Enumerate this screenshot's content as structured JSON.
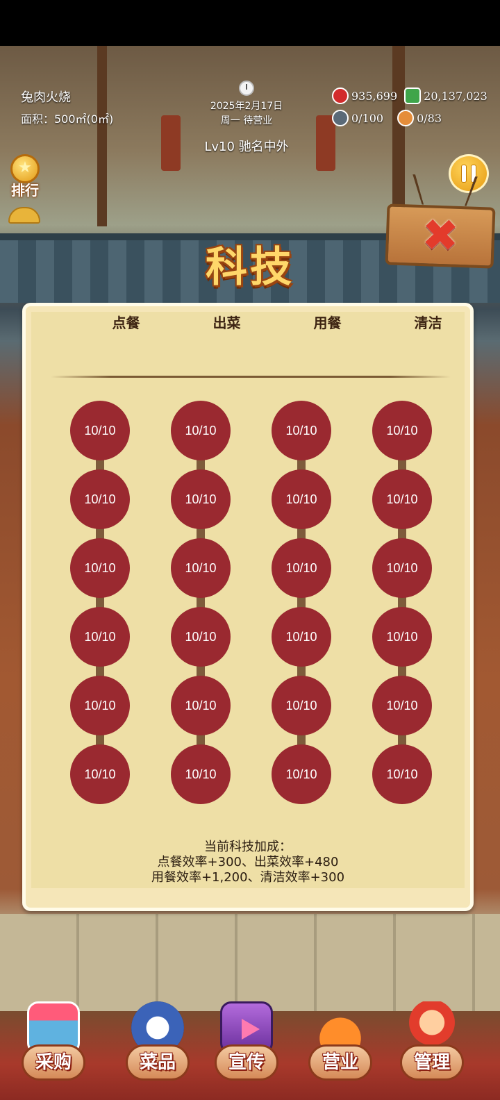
{
  "header": {
    "shop_name": "兔肉火烧",
    "area": "面积：500㎡(0㎡)",
    "date": "2025年2月17日",
    "weekday_status": "周一 待营业",
    "level": "Lv10 驰名中外"
  },
  "resources": {
    "hearts": "935,699",
    "cash": "20,137,023",
    "cooks": "0/100",
    "customers": "0/83"
  },
  "rank_label": "排行",
  "close_icon": "✖",
  "title": "科技",
  "columns": [
    {
      "name": "点餐",
      "nodes": [
        "10/10",
        "10/10",
        "10/10",
        "10/10",
        "10/10",
        "10/10"
      ]
    },
    {
      "name": "出菜",
      "nodes": [
        "10/10",
        "10/10",
        "10/10",
        "10/10",
        "10/10",
        "10/10"
      ]
    },
    {
      "name": "用餐",
      "nodes": [
        "10/10",
        "10/10",
        "10/10",
        "10/10",
        "10/10",
        "10/10"
      ]
    },
    {
      "name": "清洁",
      "nodes": [
        "10/10",
        "10/10",
        "10/10",
        "10/10",
        "10/10",
        "10/10"
      ]
    }
  ],
  "summary": {
    "line1": "当前科技加成：",
    "line2": "点餐效率+300、出菜效率+480",
    "line3": "用餐效率+1,200、清洁效率+300"
  },
  "nav": {
    "purchase": "采购",
    "dishes": "菜品",
    "promote": "宣传",
    "business": "营业",
    "manage": "管理"
  },
  "colors": {
    "node": "#9a2930",
    "panel": "#eedfa6",
    "title": "#ffd76a"
  }
}
